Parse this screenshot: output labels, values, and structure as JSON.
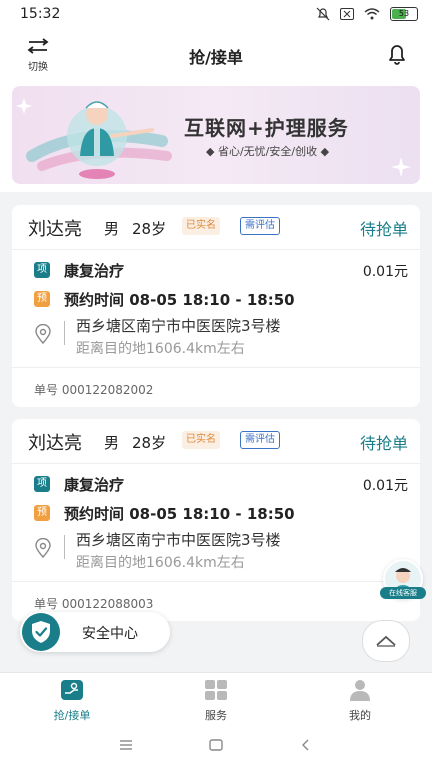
{
  "status_bar": {
    "time": "15:32",
    "battery": "53"
  },
  "header": {
    "title": "抢/接单",
    "switch_label": "切换"
  },
  "banner": {
    "title": "互联网+护理服务",
    "subtitle": "省心/无忧/安全/创收"
  },
  "orders": [
    {
      "name": "刘达亮",
      "gender": "男",
      "age": "28岁",
      "verified": "已实名",
      "assess": "需评估",
      "status": "待抢单",
      "tag1": "项",
      "service": "康复治疗",
      "price": "0.01元",
      "tag2": "预",
      "appointment": "预约时间  08-05  18:10 - 18:50",
      "address": "西乡塘区南宁市中医医院3号楼",
      "distance": "距离目的地1606.4km左右",
      "order_no": "单号 000122082002"
    },
    {
      "name": "刘达亮",
      "gender": "男",
      "age": "28岁",
      "verified": "已实名",
      "assess": "需评估",
      "status": "待抢单",
      "tag1": "项",
      "service": "康复治疗",
      "price": "0.01元",
      "tag2": "预",
      "appointment": "预约时间  08-05  18:10 - 18:50",
      "address": "西乡塘区南宁市中医医院3号楼",
      "distance": "距离目的地1606.4km左右",
      "order_no": "单号 000122088003"
    }
  ],
  "floating": {
    "safety_label": "安全中心",
    "customer_service": "在线客服"
  },
  "tabbar": {
    "tab1": "抢/接单",
    "tab2": "服务",
    "tab3": "我的"
  },
  "colors": {
    "accent": "#1a7e8a",
    "orange": "#f0a040",
    "assess_blue": "#3b73c7"
  },
  "icons": {
    "switch": "swap-arrows-icon",
    "bell": "bell-icon",
    "location": "location-pin-icon",
    "shield": "shield-check-icon",
    "up": "chevron-up-icon"
  }
}
